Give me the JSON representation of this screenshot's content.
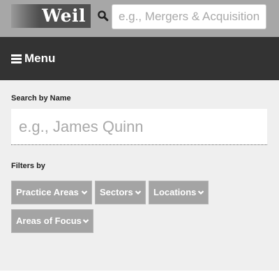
{
  "header": {
    "logo_text": "Weil",
    "search_placeholder": "e.g., Mergers & Acquisition",
    "search_icon": "search-icon"
  },
  "menu": {
    "label": "Menu",
    "icon": "hamburger-icon"
  },
  "search_by_name": {
    "label": "Search by Name",
    "placeholder": "e.g., James Quinn"
  },
  "filters": {
    "label": "Filters by",
    "buttons": [
      {
        "label": "Practice Areas",
        "icon": "chevron-down-icon"
      },
      {
        "label": "Sectors",
        "icon": "chevron-down-icon"
      },
      {
        "label": "Locations",
        "icon": "chevron-down-icon"
      },
      {
        "label": "Areas of Focus",
        "icon": "chevron-down-icon"
      }
    ]
  },
  "colors": {
    "topbar_bg": "#a7a7a7",
    "logo_bg": "#4f4f4f",
    "menubar_bg": "#333333",
    "panel_bg": "#efefef",
    "filter_button_bg": "#a4a4a4"
  }
}
